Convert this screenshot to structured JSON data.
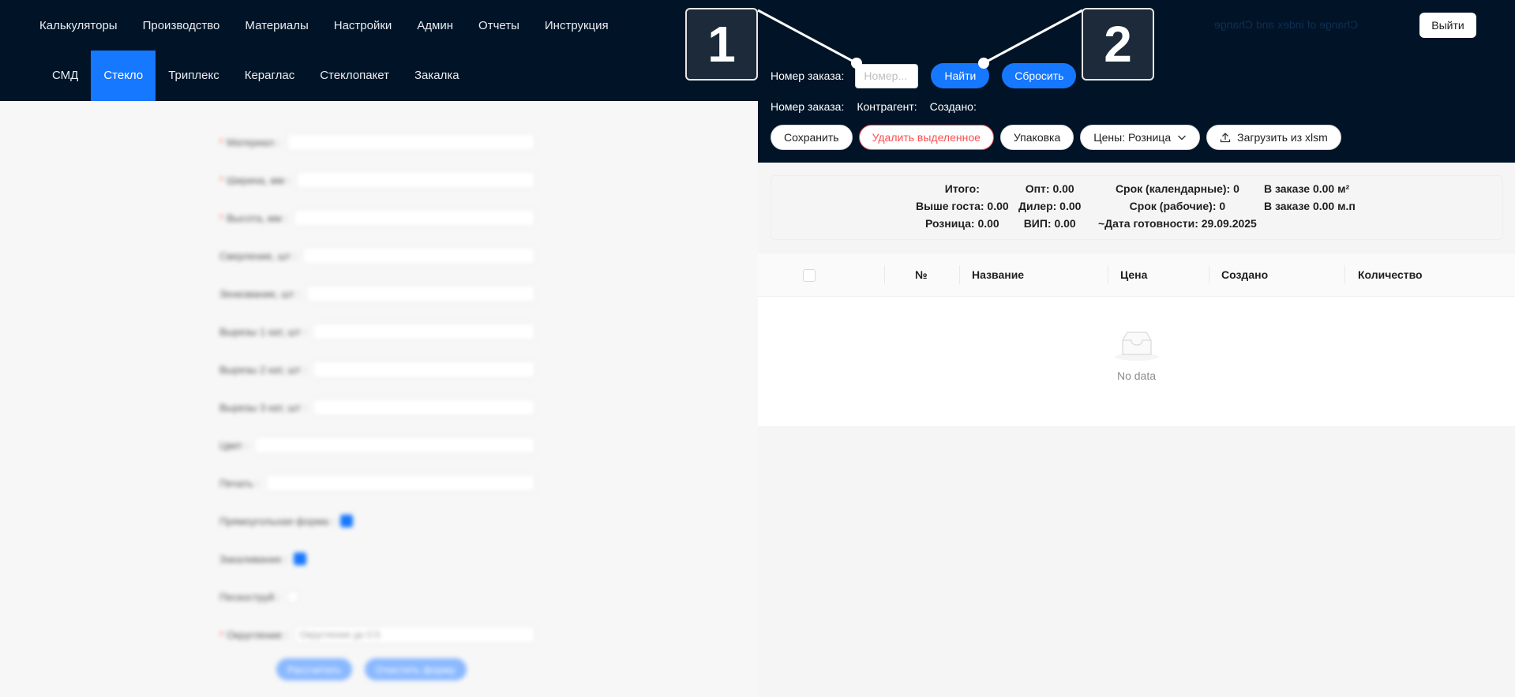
{
  "header": {
    "nav": [
      "Калькуляторы",
      "Производство",
      "Материалы",
      "Настройки",
      "Админ",
      "Отчеты",
      "Инструкция"
    ],
    "tabs": [
      "СМД",
      "Стекло",
      "Триплекс",
      "Кераглас",
      "Стеклопакет",
      "Закалка"
    ],
    "active_tab": "Стекло",
    "mirrored_text": "Change of index and Change",
    "logout": "Выйти"
  },
  "search": {
    "label": "Номер заказа:",
    "placeholder": "Номер...",
    "find": "Найти",
    "reset": "Сбросить"
  },
  "info": {
    "order": "Номер заказа:",
    "counterparty": "Контрагент:",
    "created": "Создано:"
  },
  "actions": {
    "save": "Сохранить",
    "delete": "Удалить выделенное",
    "pack": "Упаковка",
    "prices": "Цены: Розница",
    "upload": "Загрузить из xlsm"
  },
  "summary": {
    "total": "Итого:",
    "above_gost": "Выше госта: 0.00",
    "retail": "Розница: 0.00",
    "opt": "Опт: 0.00",
    "dealer": "Дилер: 0.00",
    "vip": "ВИП: 0.00",
    "term_cal": "Срок (календарные): 0",
    "term_work": "Срок (рабочие): 0",
    "ready_date": "~Дата готовности: 29.09.2025",
    "in_order_m2": "В заказе 0.00 м²",
    "in_order_mp": "В заказе 0.00 м.п"
  },
  "table": {
    "columns": [
      "№",
      "Название",
      "Цена",
      "Создано",
      "Количество"
    ],
    "empty": "No data"
  },
  "form": {
    "fields": [
      {
        "label": "Материал :",
        "required": true,
        "type": "select"
      },
      {
        "label": "Ширина, мм :",
        "required": true,
        "type": "input"
      },
      {
        "label": "Высота, мм :",
        "required": true,
        "type": "input"
      },
      {
        "label": "Сверление, шт :",
        "required": false,
        "type": "input"
      },
      {
        "label": "Зенкование, шт :",
        "required": false,
        "type": "input"
      },
      {
        "label": "Вырезы 1 кат, шт :",
        "required": false,
        "type": "input"
      },
      {
        "label": "Вырезы 2 кат, шт :",
        "required": false,
        "type": "input"
      },
      {
        "label": "Вырезы 3 кат, шт :",
        "required": false,
        "type": "input"
      },
      {
        "label": "Цвет :",
        "required": false,
        "type": "select"
      },
      {
        "label": "Печать :",
        "required": false,
        "type": "select"
      },
      {
        "label": "Прямоугольная форма :",
        "required": false,
        "type": "checkbox"
      },
      {
        "label": "Закаливание :",
        "required": false,
        "type": "checkbox"
      },
      {
        "label": "Пескоструй :",
        "required": false,
        "type": "checkbox-off"
      },
      {
        "label": "Округление :",
        "required": true,
        "type": "select"
      }
    ],
    "rounding_placeholder": "Округление до 0.5",
    "calc": "Рассчитать",
    "clear": "Очистить форму"
  },
  "annotations": [
    "1",
    "2"
  ]
}
